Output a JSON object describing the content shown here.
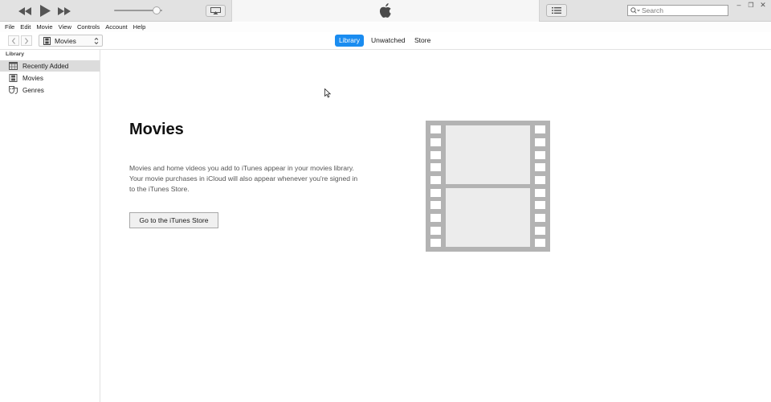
{
  "window": {
    "search_placeholder": "Search",
    "controls": {
      "minimize": "–",
      "restore": "❐",
      "close": "✕"
    }
  },
  "player": {
    "icons": [
      "rewind-icon",
      "play-icon",
      "fast-forward-icon",
      "airplay-icon",
      "apple-logo-icon",
      "list-view-icon",
      "search-icon"
    ],
    "volume_level": 0.88
  },
  "menu": {
    "items": [
      "File",
      "Edit",
      "Movie",
      "View",
      "Controls",
      "Account",
      "Help"
    ]
  },
  "navbar": {
    "media_kind": "Movies",
    "tabs": [
      {
        "label": "Library",
        "active": true
      },
      {
        "label": "Unwatched",
        "active": false
      },
      {
        "label": "Store",
        "active": false
      }
    ]
  },
  "sidebar": {
    "heading": "Library",
    "items": [
      {
        "label": "Recently Added",
        "icon": "calendar-grid-icon",
        "selected": true
      },
      {
        "label": "Movies",
        "icon": "film-icon",
        "selected": false
      },
      {
        "label": "Genres",
        "icon": "masks-icon",
        "selected": false
      }
    ]
  },
  "main": {
    "title": "Movies",
    "description": "Movies and home videos you add to iTunes appear in your movies library. Your movie purchases in iCloud will also appear whenever you're signed in to the iTunes Store.",
    "button_label": "Go to the iTunes Store"
  },
  "colors": {
    "accent": "#1a8cf0",
    "film_strip": "#b3b3b3",
    "film_frame": "#ececec",
    "toolbar_bg": "#e2e2e2"
  }
}
